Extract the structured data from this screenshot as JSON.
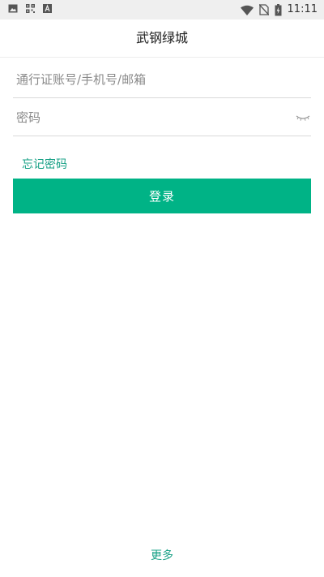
{
  "status_bar": {
    "time": "11:11",
    "left_icons": [
      "image-icon",
      "qr-code-icon",
      "text-a-icon"
    ],
    "right_icons": [
      "wifi-icon",
      "no-sim-icon",
      "battery-charging-icon"
    ]
  },
  "header": {
    "title": "武钢绿城"
  },
  "form": {
    "account_placeholder": "通行证账号/手机号/邮箱",
    "account_value": "",
    "password_placeholder": "密码",
    "password_value": "",
    "password_toggle_icon": "eye-closed-icon"
  },
  "forgot_password_label": "忘记密码",
  "login_button_label": "登录",
  "more_label": "更多",
  "colors": {
    "accent": "#00b386",
    "link": "#16a085",
    "status_bar_bg": "#efefef"
  }
}
